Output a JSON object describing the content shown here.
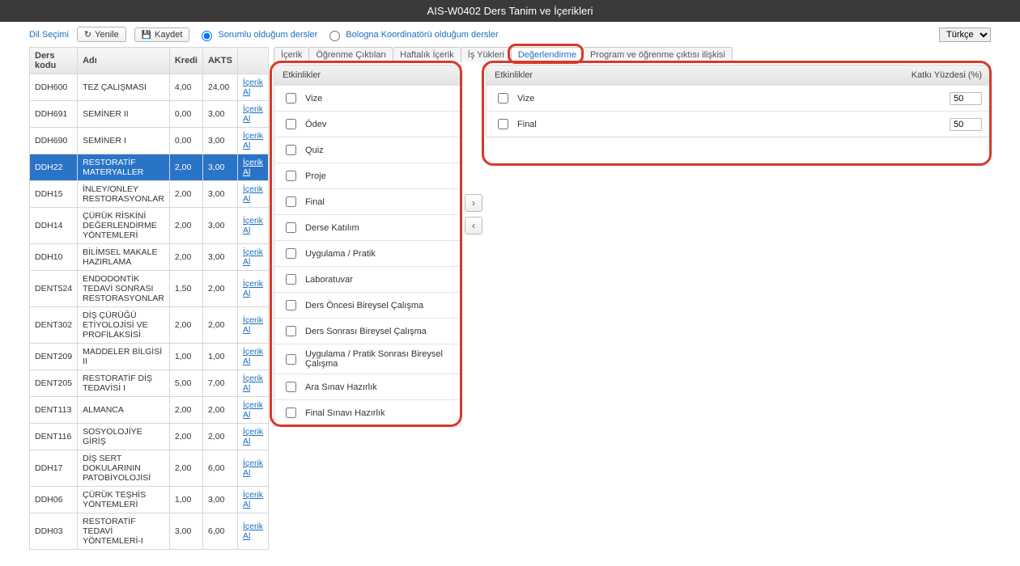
{
  "title": "AIS-W0402 Ders Tanim ve İçerikleri",
  "toolbar": {
    "dil_secimi": "Dil Seçimi",
    "yenile": "Yenile",
    "kaydet": "Kaydet",
    "radio1": "Sorumlu olduğum dersler",
    "radio2": "Bologna Koordinatörü olduğum dersler",
    "lang_selected": "Türkçe"
  },
  "course_headers": {
    "kod": "Ders kodu",
    "ad": "Adı",
    "kredi": "Kredi",
    "akts": "AKTS",
    "link": ""
  },
  "icerik_al": "İçerik Al",
  "courses": [
    {
      "kod": "DDH600",
      "ad": "TEZ ÇALIŞMASI",
      "kredi": "4,00",
      "akts": "24,00"
    },
    {
      "kod": "DDH691",
      "ad": "SEMİNER II",
      "kredi": "0,00",
      "akts": "3,00"
    },
    {
      "kod": "DDH690",
      "ad": "SEMİNER I",
      "kredi": "0,00",
      "akts": "3,00"
    },
    {
      "kod": "DDH22",
      "ad": "RESTORATİF MATERYALLER",
      "kredi": "2,00",
      "akts": "3,00",
      "selected": true
    },
    {
      "kod": "DDH15",
      "ad": "İNLEY/ONLEY RESTORASYONLAR",
      "kredi": "2,00",
      "akts": "3,00"
    },
    {
      "kod": "DDH14",
      "ad": "ÇÜRÜK RİSKİNİ DEĞERLENDİRME YÖNTEMLERİ",
      "kredi": "2,00",
      "akts": "3,00"
    },
    {
      "kod": "DDH10",
      "ad": "BİLİMSEL MAKALE HAZIRLAMA",
      "kredi": "2,00",
      "akts": "3,00"
    },
    {
      "kod": "DENT524",
      "ad": "ENDODONTİK TEDAVİ SONRASI RESTORASYONLAR",
      "kredi": "1,50",
      "akts": "2,00"
    },
    {
      "kod": "DENT302",
      "ad": "DİŞ ÇÜRÜĞÜ ETİYOLOJİSİ VE PROFİLAKSİSİ",
      "kredi": "2,00",
      "akts": "2,00"
    },
    {
      "kod": "DENT209",
      "ad": "MADDELER BİLGİSİ II",
      "kredi": "1,00",
      "akts": "1,00"
    },
    {
      "kod": "DENT205",
      "ad": "RESTORATİF DİŞ TEDAVİSİ I",
      "kredi": "5,00",
      "akts": "7,00"
    },
    {
      "kod": "DENT113",
      "ad": "ALMANCA",
      "kredi": "2,00",
      "akts": "2,00"
    },
    {
      "kod": "DENT116",
      "ad": "SOSYOLOJİYE GİRİŞ",
      "kredi": "2,00",
      "akts": "2,00"
    },
    {
      "kod": "DDH17",
      "ad": "DİŞ SERT DOKULARININ PATOBİYOLOJİSİ",
      "kredi": "2,00",
      "akts": "6,00"
    },
    {
      "kod": "DDH06",
      "ad": "ÇÜRÜK TEŞHİS YÖNTEMLERİ",
      "kredi": "1,00",
      "akts": "3,00"
    },
    {
      "kod": "DDH03",
      "ad": "RESTORATİF TEDAVİ YÖNTEMLERİ-I",
      "kredi": "3,00",
      "akts": "6,00"
    }
  ],
  "tabs": [
    "İçerik",
    "Öğrenme Çıktıları",
    "Haftalık İçerik",
    "İş Yükleri",
    "Değerlendirme",
    "Program ve öğrenme çıktısı ilişkisi"
  ],
  "active_tab": 4,
  "left_panel": {
    "header": "Etkinlikler",
    "items": [
      "Vize",
      "Ödev",
      "Quiz",
      "Proje",
      "Final",
      "Derse Katılım",
      "Uygulama / Pratik",
      "Laboratuvar",
      "Ders Öncesi Bireysel Çalışma",
      "Ders Sonrası Bireysel Çalışma",
      "Uygulama / Pratik Sonrası Bireysel Çalışma",
      "Ara Sınav Hazırlık",
      "Final Sınavı Hazırlık"
    ]
  },
  "right_panel": {
    "header_left": "Etkinlikler",
    "header_right": "Katkı Yüzdesi (%)",
    "items": [
      {
        "name": "Vize",
        "pct": "50"
      },
      {
        "name": "Final",
        "pct": "50"
      }
    ]
  },
  "move": {
    "right": "›",
    "left": "‹"
  }
}
